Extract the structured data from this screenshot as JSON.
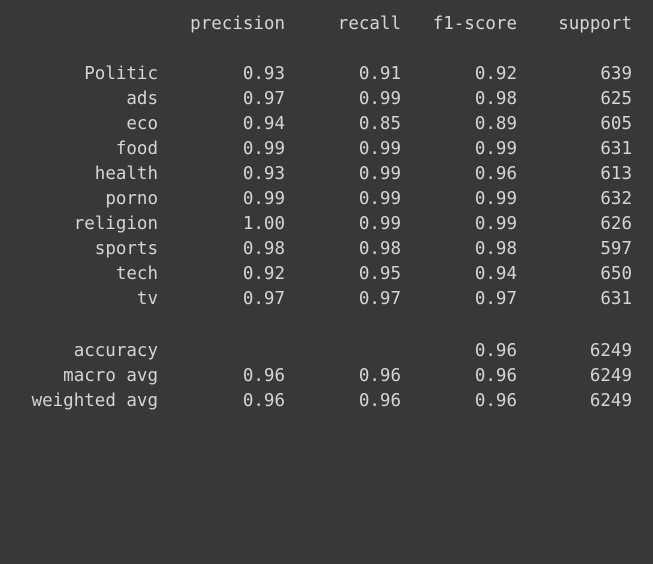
{
  "headers": {
    "label": "",
    "precision": "precision",
    "recall": "recall",
    "f1": "f1-score",
    "support": "support"
  },
  "rows": [
    {
      "label": "Politic",
      "precision": "0.93",
      "recall": "0.91",
      "f1": "0.92",
      "support": "639"
    },
    {
      "label": "ads",
      "precision": "0.97",
      "recall": "0.99",
      "f1": "0.98",
      "support": "625"
    },
    {
      "label": "eco",
      "precision": "0.94",
      "recall": "0.85",
      "f1": "0.89",
      "support": "605"
    },
    {
      "label": "food",
      "precision": "0.99",
      "recall": "0.99",
      "f1": "0.99",
      "support": "631"
    },
    {
      "label": "health",
      "precision": "0.93",
      "recall": "0.99",
      "f1": "0.96",
      "support": "613"
    },
    {
      "label": "porno",
      "precision": "0.99",
      "recall": "0.99",
      "f1": "0.99",
      "support": "632"
    },
    {
      "label": "religion",
      "precision": "1.00",
      "recall": "0.99",
      "f1": "0.99",
      "support": "626"
    },
    {
      "label": "sports",
      "precision": "0.98",
      "recall": "0.98",
      "f1": "0.98",
      "support": "597"
    },
    {
      "label": "tech",
      "precision": "0.92",
      "recall": "0.95",
      "f1": "0.94",
      "support": "650"
    },
    {
      "label": "tv",
      "precision": "0.97",
      "recall": "0.97",
      "f1": "0.97",
      "support": "631"
    }
  ],
  "summary": [
    {
      "label": "accuracy",
      "precision": "",
      "recall": "",
      "f1": "0.96",
      "support": "6249"
    },
    {
      "label": "macro avg",
      "precision": "0.96",
      "recall": "0.96",
      "f1": "0.96",
      "support": "6249"
    },
    {
      "label": "weighted avg",
      "precision": "0.96",
      "recall": "0.96",
      "f1": "0.96",
      "support": "6249"
    }
  ],
  "colors": {
    "background": "#383838",
    "text": "#d4d4d4"
  }
}
